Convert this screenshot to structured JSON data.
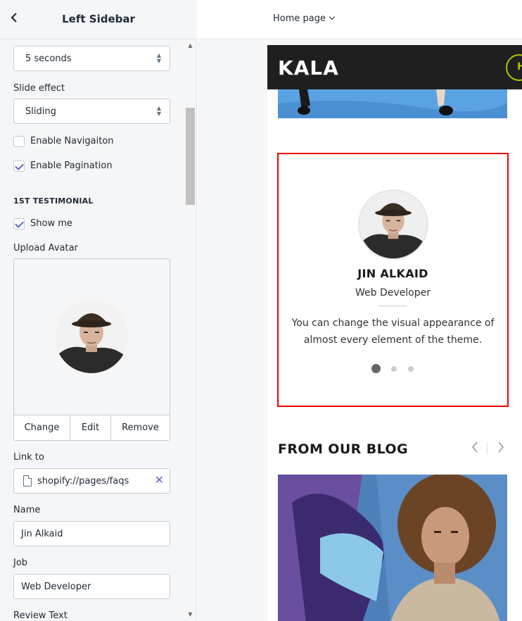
{
  "left_panel": {
    "title": "Left Sidebar",
    "back_icon": "chevron-left-icon",
    "slide_speed": {
      "value": "5 seconds"
    },
    "slide_effect": {
      "label": "Slide effect",
      "value": "Sliding"
    },
    "enable_navigation": {
      "label": "Enable Navigaiton",
      "checked": false
    },
    "enable_pagination": {
      "label": "Enable Pagination",
      "checked": true
    },
    "section_heading": "1ST TESTIMONIAL",
    "show_me": {
      "label": "Show me",
      "checked": true
    },
    "upload_avatar": {
      "label": "Upload Avatar",
      "buttons": [
        "Change",
        "Edit",
        "Remove"
      ]
    },
    "link_to": {
      "label": "Link to",
      "value": "shopify://pages/faqs"
    },
    "name": {
      "label": "Name",
      "value": "Jin Alkaid"
    },
    "job": {
      "label": "Job",
      "value": "Web Developer"
    },
    "review_text": {
      "label": "Review Text"
    }
  },
  "top_bar": {
    "page_selector": "Home page"
  },
  "preview": {
    "logo": "KALA",
    "header_button_initial": "H",
    "testimonial": {
      "name": "JIN ALKAID",
      "job": "Web Developer",
      "review": "You can change the visual appearance of almost every element of the theme.",
      "pagination": {
        "count": 3,
        "active": 0
      }
    },
    "blog": {
      "title": "FROM OUR BLOG",
      "prev_icon": "chevron-left-icon",
      "next_icon": "chevron-right-icon"
    }
  },
  "colors": {
    "accent": "#5c6ac4",
    "highlight_border": "#e00000",
    "header_bg": "#1f1f1f",
    "logo_accent": "#b4c400"
  }
}
